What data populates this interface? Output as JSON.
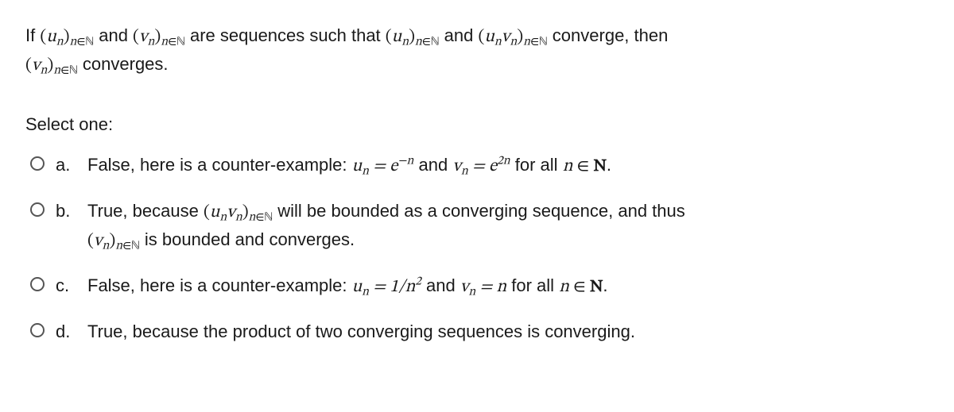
{
  "question": {
    "s1": "If ",
    "s2": " and ",
    "s3": " are sequences such that ",
    "s4": " and ",
    "s5": " converge, then ",
    "s6": " converges.",
    "seq_u": "(uₙ)",
    "seq_v": "(vₙ)",
    "seq_uv": "(uₙvₙ)",
    "sub_nN": "n∈N"
  },
  "select_prompt": "Select one:",
  "options": {
    "a": {
      "label": "a.",
      "t1": "False, here is a counter-example: ",
      "u_eq": "uₙ = e",
      "exp_neg_n": "−n",
      "t2": " and ",
      "v_eq": "vₙ = e",
      "exp_2n": "2n",
      "t3": " for all ",
      "n_in_N": "n ∈ N",
      "t4": "."
    },
    "b": {
      "label": "b.",
      "t1": "True, because ",
      "t2": " will be bounded as a converging sequence, and thus ",
      "t3": " is bounded and converges."
    },
    "c": {
      "label": "c.",
      "t1": "False, here is a counter-example: ",
      "u_eq": "uₙ = 1/n",
      "exp_2": "2",
      "t2": " and ",
      "v_eq": "vₙ = n",
      "t3": " for all ",
      "n_in_N": "n ∈ N",
      "t4": "."
    },
    "d": {
      "label": "d.",
      "t1": "True, because the product of two converging sequences is converging."
    }
  }
}
